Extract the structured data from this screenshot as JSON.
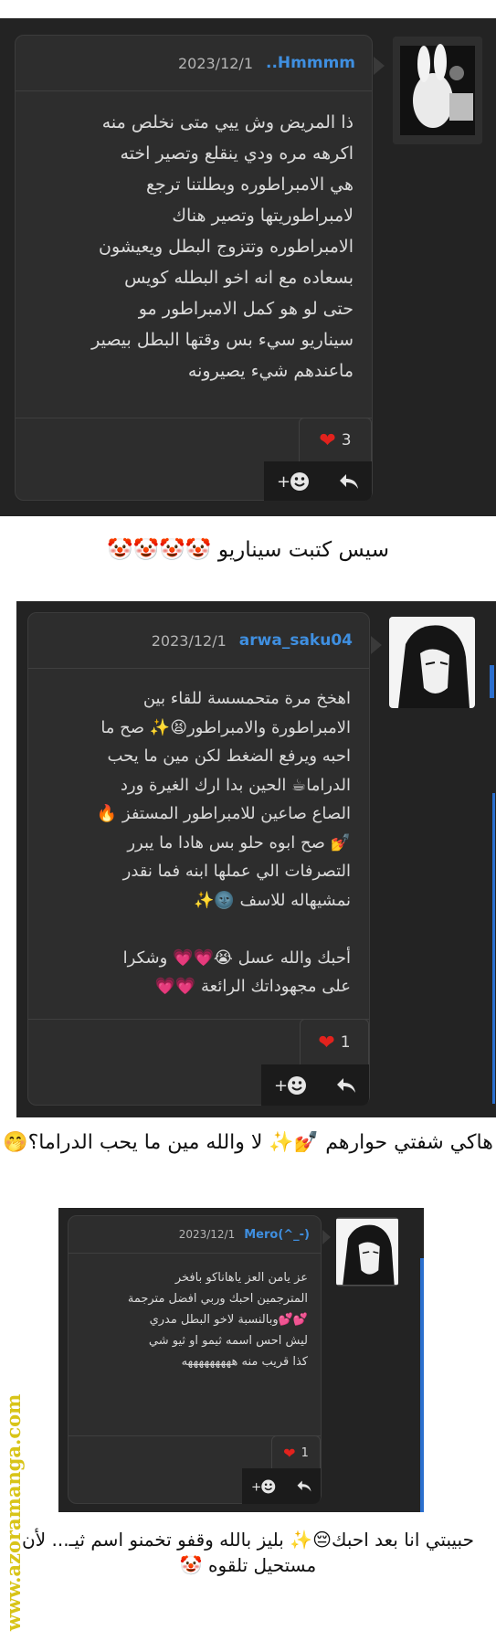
{
  "watermark": "www.azoramanga.com",
  "posts": [
    {
      "username": "..Hmmmm",
      "date": "2023/12/1",
      "body": "ذا المريض وش ييي متى نخلص منه\nاكرهه مره ودي ينقلع وتصير اخته\nهي الامبراطوره وبطلتنا ترجع\nلامبراطوريتها وتصير هناك\nالامبراطوره وتتزوج البطل ويعيشون\nبسعاده مع انه اخو البطله كويس\nحتى لو هو كمل الامبراطور مو\nسيناريو سيء بس وقتها البطل بيصير\nماعندهم شيء يصيرونه",
      "likes": "3",
      "comment": "سيس كتبت سيناريو 🤡🤡🤡🤡"
    },
    {
      "username": "arwa_saku04",
      "date": "2023/12/1",
      "body": "اهخخ مرة متحمسسة للقاء بين\nالامبراطورة والامبراطور😫✨ صح ما\nاحبه ويرفع الضغط لكن مين ما يحب\nالدراما☕ الحين بدا ارك الغيرة ورد\nالصاع صاعين للامبراطور المستفز 🔥\n💅 صح ابوه حلو بس هادا ما يبرر\nالتصرفات الي عملها ابنه فما نقدر\nنمشيهاله للاسف 🌚✨\n\nأحبك والله عسل 😭💗💗 وشكرا\nعلى مجهوداتك الرائعة 💗💗",
      "likes": "1",
      "comment": "هاكي شفتي حوارهم 💅✨\nلا والله مين ما يحب الدراما؟🤭"
    },
    {
      "username": "Mero(^_-)",
      "date": "2023/12/1",
      "body": "عز يامن العز ياهاناكو بافخر\nالمترجمين احبك وربي افضل مترجمة\n💕💕وبالنسبة لاخو البطل مدري\nليش احس اسمه ثيمو او ثيو شي\nكذا قريب منه هههههههههه",
      "likes": "1",
      "comment": "حبيبتي انا بعد احبك😔✨\nبليز بالله وقفو تخمنو اسم ثيـ... لأن\nمستحيل تلقوه 🤡"
    }
  ],
  "icons": {
    "like": "heart-icon",
    "react": "add-reaction-icon",
    "reply": "reply-icon"
  },
  "colors": {
    "panel": "#232323",
    "card": "#2d2d2d",
    "username": "#3f8fe0",
    "heart": "#e2221d",
    "watermark": "#d8c418"
  }
}
